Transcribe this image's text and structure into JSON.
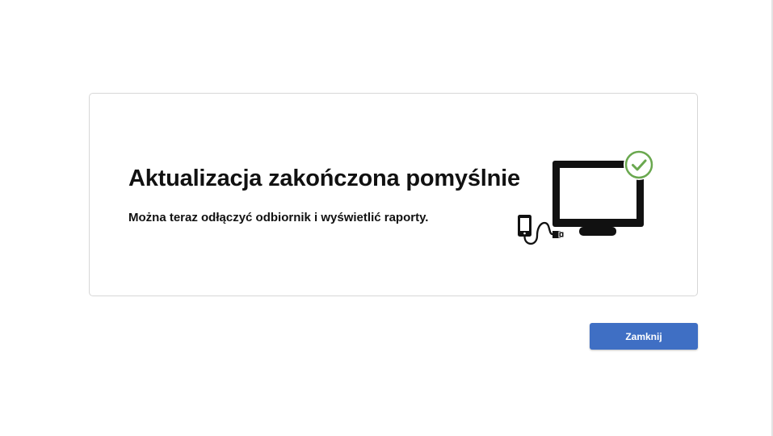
{
  "dialog": {
    "title": "Aktualizacja zakończona pomyślnie",
    "message": "Można teraz odłączyć odbiornik i wyświetlić raporty.",
    "illustration": {
      "icons": [
        "phone-icon",
        "usb-cable-icon",
        "monitor-icon",
        "success-checkmark-icon"
      ],
      "success_color": "#6aa84f",
      "icon_color": "#111111"
    }
  },
  "actions": {
    "close_label": "Zamknij",
    "button_color": "#3f6fc4"
  }
}
